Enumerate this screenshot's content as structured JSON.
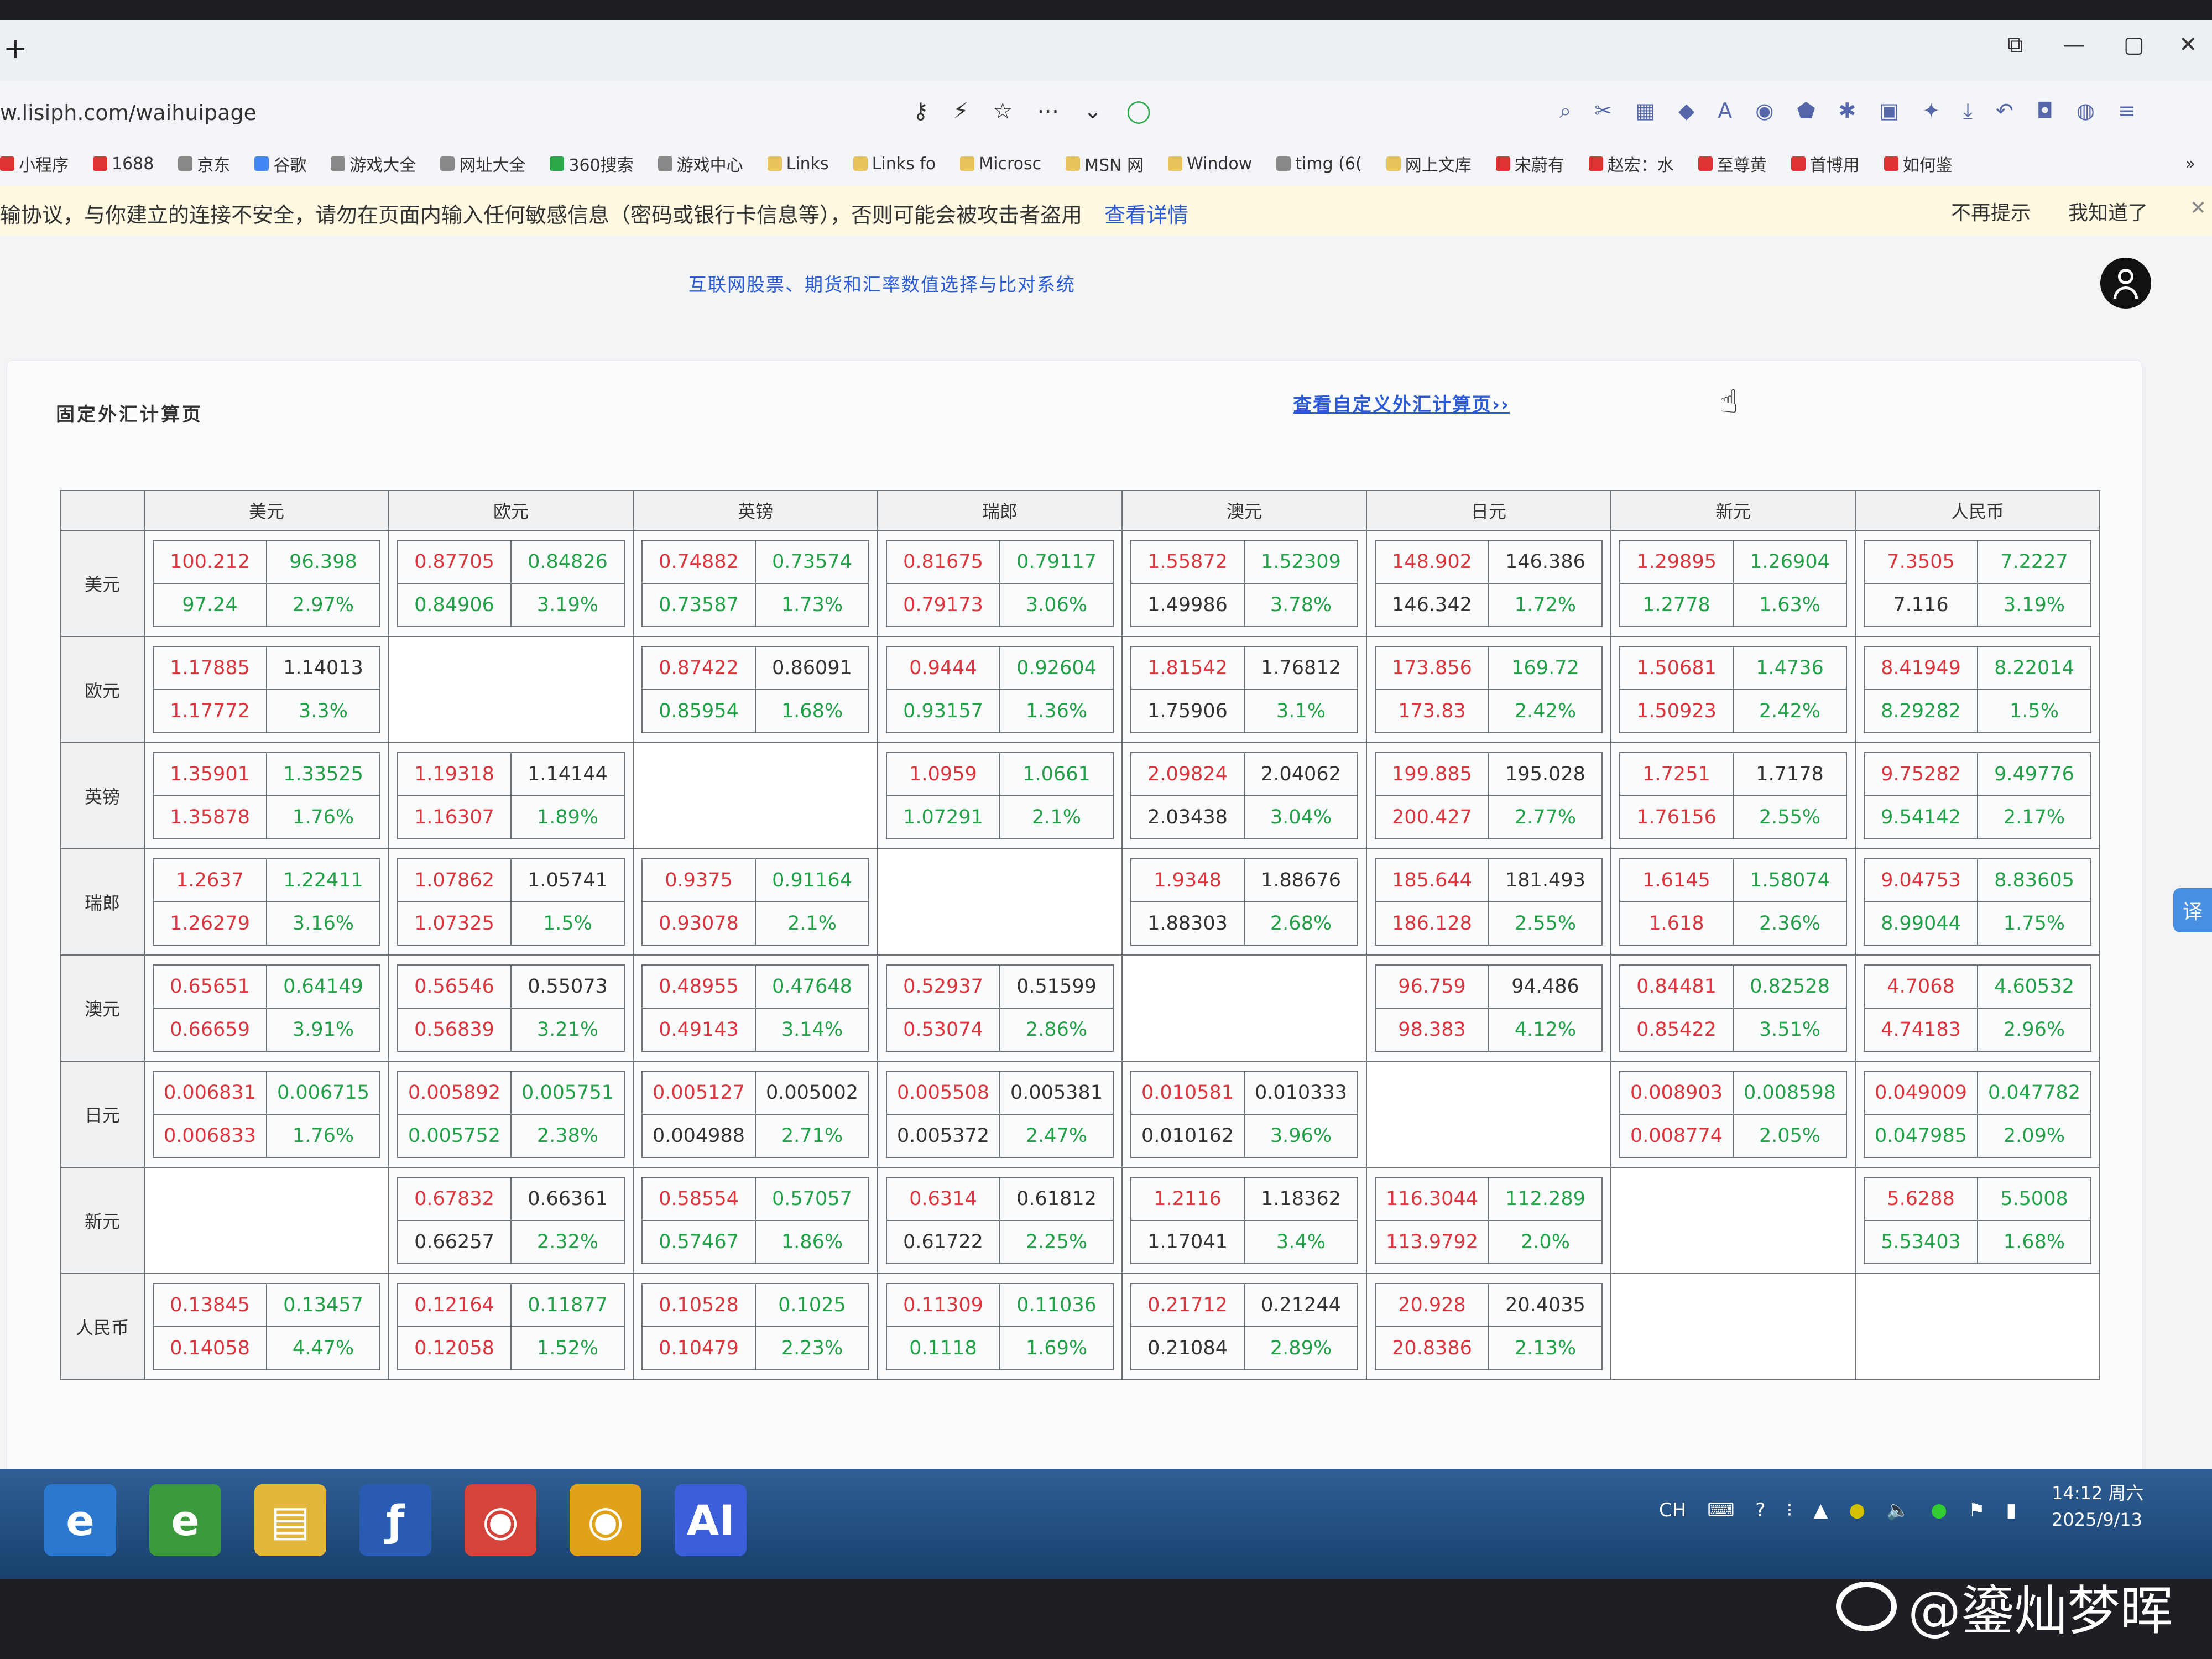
{
  "browser": {
    "new_tab_icon": "+",
    "url": "w.lisiph.com/waihuipage",
    "window_controls": [
      "⧉",
      "—",
      "▢",
      "✕"
    ],
    "bookmarks": [
      {
        "label": "小程序",
        "icon": "red"
      },
      {
        "label": "1688",
        "icon": "red"
      },
      {
        "label": "京东",
        "icon": "gear"
      },
      {
        "label": "谷歌",
        "icon": "g"
      },
      {
        "label": "游戏大全",
        "icon": "gear"
      },
      {
        "label": "网址大全",
        "icon": "gear"
      },
      {
        "label": "360搜索",
        "icon": "green"
      },
      {
        "label": "游戏中心",
        "icon": "gear"
      },
      {
        "label": "Links",
        "icon": "folder"
      },
      {
        "label": "Links fo",
        "icon": "folder"
      },
      {
        "label": "Microsc",
        "icon": "folder"
      },
      {
        "label": "MSN 网",
        "icon": "folder"
      },
      {
        "label": "Window",
        "icon": "folder"
      },
      {
        "label": "timg (6(",
        "icon": "gear"
      },
      {
        "label": "网上文库",
        "icon": "folder"
      },
      {
        "label": "宋蔚有",
        "icon": "red"
      },
      {
        "label": "赵宏：水",
        "icon": "red"
      },
      {
        "label": "至尊黄",
        "icon": "red"
      },
      {
        "label": "首博用",
        "icon": "red"
      },
      {
        "label": "如何鉴",
        "icon": "red"
      }
    ],
    "more_bookmarks": "»"
  },
  "warning": {
    "message": "输协议，与你建立的连接不安全，请勿在页面内输入任何敏感信息（密码或银行卡信息等），否则可能会被攻击者盗用",
    "details_link": "查看详情",
    "dont_remind": "不再提示",
    "got_it": "我知道了",
    "close": "✕"
  },
  "page": {
    "system_title": "互联网股票、期货和汇率数值选择与比对系统",
    "panel_title": "固定外汇计算页",
    "custom_link": "查看自定义外汇计算页››"
  },
  "table": {
    "columns": [
      "美元",
      "欧元",
      "英镑",
      "瑞郎",
      "澳元",
      "日元",
      "新元",
      "人民币"
    ],
    "rows": [
      {
        "label": "美元",
        "cells": [
          [
            [
              "100.212",
              "r"
            ],
            [
              "96.398",
              "g"
            ],
            [
              "97.24",
              "g"
            ],
            [
              "2.97%",
              "g"
            ]
          ],
          [
            [
              "0.87705",
              "r"
            ],
            [
              "0.84826",
              "g"
            ],
            [
              "0.84906",
              "g"
            ],
            [
              "3.19%",
              "g"
            ]
          ],
          [
            [
              "0.74882",
              "r"
            ],
            [
              "0.73574",
              "g"
            ],
            [
              "0.73587",
              "g"
            ],
            [
              "1.73%",
              "g"
            ]
          ],
          [
            [
              "0.81675",
              "r"
            ],
            [
              "0.79117",
              "g"
            ],
            [
              "0.79173",
              "r"
            ],
            [
              "3.06%",
              "g"
            ]
          ],
          [
            [
              "1.55872",
              "r"
            ],
            [
              "1.52309",
              "g"
            ],
            [
              "1.49986",
              "k"
            ],
            [
              "3.78%",
              "g"
            ]
          ],
          [
            [
              "148.902",
              "r"
            ],
            [
              "146.386",
              "k"
            ],
            [
              "146.342",
              "k"
            ],
            [
              "1.72%",
              "g"
            ]
          ],
          [
            [
              "1.29895",
              "r"
            ],
            [
              "1.26904",
              "g"
            ],
            [
              "1.2778",
              "g"
            ],
            [
              "1.63%",
              "g"
            ]
          ],
          [
            [
              "7.3505",
              "r"
            ],
            [
              "7.2227",
              "g"
            ],
            [
              "7.116",
              "k"
            ],
            [
              "3.19%",
              "g"
            ]
          ]
        ]
      },
      {
        "label": "欧元",
        "cells": [
          [
            [
              "1.17885",
              "r"
            ],
            [
              "1.14013",
              "k"
            ],
            [
              "1.17772",
              "r"
            ],
            [
              "3.3%",
              "g"
            ]
          ],
          null,
          [
            [
              "0.87422",
              "r"
            ],
            [
              "0.86091",
              "k"
            ],
            [
              "0.85954",
              "g"
            ],
            [
              "1.68%",
              "g"
            ]
          ],
          [
            [
              "0.9444",
              "r"
            ],
            [
              "0.92604",
              "g"
            ],
            [
              "0.93157",
              "g"
            ],
            [
              "1.36%",
              "g"
            ]
          ],
          [
            [
              "1.81542",
              "r"
            ],
            [
              "1.76812",
              "k"
            ],
            [
              "1.75906",
              "k"
            ],
            [
              "3.1%",
              "g"
            ]
          ],
          [
            [
              "173.856",
              "r"
            ],
            [
              "169.72",
              "g"
            ],
            [
              "173.83",
              "r"
            ],
            [
              "2.42%",
              "g"
            ]
          ],
          [
            [
              "1.50681",
              "r"
            ],
            [
              "1.4736",
              "g"
            ],
            [
              "1.50923",
              "r"
            ],
            [
              "2.42%",
              "g"
            ]
          ],
          [
            [
              "8.41949",
              "r"
            ],
            [
              "8.22014",
              "g"
            ],
            [
              "8.29282",
              "g"
            ],
            [
              "1.5%",
              "g"
            ]
          ]
        ]
      },
      {
        "label": "英镑",
        "cells": [
          [
            [
              "1.35901",
              "r"
            ],
            [
              "1.33525",
              "g"
            ],
            [
              "1.35878",
              "r"
            ],
            [
              "1.76%",
              "g"
            ]
          ],
          [
            [
              "1.19318",
              "r"
            ],
            [
              "1.14144",
              "k"
            ],
            [
              "1.16307",
              "r"
            ],
            [
              "1.89%",
              "g"
            ]
          ],
          null,
          [
            [
              "1.0959",
              "r"
            ],
            [
              "1.0661",
              "g"
            ],
            [
              "1.07291",
              "g"
            ],
            [
              "2.1%",
              "g"
            ]
          ],
          [
            [
              "2.09824",
              "r"
            ],
            [
              "2.04062",
              "k"
            ],
            [
              "2.03438",
              "k"
            ],
            [
              "3.04%",
              "g"
            ]
          ],
          [
            [
              "199.885",
              "r"
            ],
            [
              "195.028",
              "k"
            ],
            [
              "200.427",
              "r"
            ],
            [
              "2.77%",
              "g"
            ]
          ],
          [
            [
              "1.7251",
              "r"
            ],
            [
              "1.7178",
              "k"
            ],
            [
              "1.76156",
              "r"
            ],
            [
              "2.55%",
              "g"
            ]
          ],
          [
            [
              "9.75282",
              "r"
            ],
            [
              "9.49776",
              "g"
            ],
            [
              "9.54142",
              "g"
            ],
            [
              "2.17%",
              "g"
            ]
          ]
        ]
      },
      {
        "label": "瑞郎",
        "cells": [
          [
            [
              "1.2637",
              "r"
            ],
            [
              "1.22411",
              "g"
            ],
            [
              "1.26279",
              "r"
            ],
            [
              "3.16%",
              "g"
            ]
          ],
          [
            [
              "1.07862",
              "r"
            ],
            [
              "1.05741",
              "k"
            ],
            [
              "1.07325",
              "r"
            ],
            [
              "1.5%",
              "g"
            ]
          ],
          [
            [
              "0.9375",
              "r"
            ],
            [
              "0.91164",
              "g"
            ],
            [
              "0.93078",
              "r"
            ],
            [
              "2.1%",
              "g"
            ]
          ],
          null,
          [
            [
              "1.9348",
              "r"
            ],
            [
              "1.88676",
              "k"
            ],
            [
              "1.88303",
              "k"
            ],
            [
              "2.68%",
              "g"
            ]
          ],
          [
            [
              "185.644",
              "r"
            ],
            [
              "181.493",
              "k"
            ],
            [
              "186.128",
              "r"
            ],
            [
              "2.55%",
              "g"
            ]
          ],
          [
            [
              "1.6145",
              "r"
            ],
            [
              "1.58074",
              "g"
            ],
            [
              "1.618",
              "r"
            ],
            [
              "2.36%",
              "g"
            ]
          ],
          [
            [
              "9.04753",
              "r"
            ],
            [
              "8.83605",
              "g"
            ],
            [
              "8.99044",
              "g"
            ],
            [
              "1.75%",
              "g"
            ]
          ]
        ]
      },
      {
        "label": "澳元",
        "cells": [
          [
            [
              "0.65651",
              "r"
            ],
            [
              "0.64149",
              "g"
            ],
            [
              "0.66659",
              "r"
            ],
            [
              "3.91%",
              "g"
            ]
          ],
          [
            [
              "0.56546",
              "r"
            ],
            [
              "0.55073",
              "k"
            ],
            [
              "0.56839",
              "r"
            ],
            [
              "3.21%",
              "g"
            ]
          ],
          [
            [
              "0.48955",
              "r"
            ],
            [
              "0.47648",
              "g"
            ],
            [
              "0.49143",
              "r"
            ],
            [
              "3.14%",
              "g"
            ]
          ],
          [
            [
              "0.52937",
              "r"
            ],
            [
              "0.51599",
              "k"
            ],
            [
              "0.53074",
              "r"
            ],
            [
              "2.86%",
              "g"
            ]
          ],
          null,
          [
            [
              "96.759",
              "r"
            ],
            [
              "94.486",
              "k"
            ],
            [
              "98.383",
              "r"
            ],
            [
              "4.12%",
              "g"
            ]
          ],
          [
            [
              "0.84481",
              "r"
            ],
            [
              "0.82528",
              "g"
            ],
            [
              "0.85422",
              "r"
            ],
            [
              "3.51%",
              "g"
            ]
          ],
          [
            [
              "4.7068",
              "r"
            ],
            [
              "4.60532",
              "g"
            ],
            [
              "4.74183",
              "r"
            ],
            [
              "2.96%",
              "g"
            ]
          ]
        ]
      },
      {
        "label": "日元",
        "cells": [
          [
            [
              "0.006831",
              "r"
            ],
            [
              "0.006715",
              "g"
            ],
            [
              "0.006833",
              "r"
            ],
            [
              "1.76%",
              "g"
            ]
          ],
          [
            [
              "0.005892",
              "r"
            ],
            [
              "0.005751",
              "g"
            ],
            [
              "0.005752",
              "g"
            ],
            [
              "2.38%",
              "g"
            ]
          ],
          [
            [
              "0.005127",
              "r"
            ],
            [
              "0.005002",
              "k"
            ],
            [
              "0.004988",
              "k"
            ],
            [
              "2.71%",
              "g"
            ]
          ],
          [
            [
              "0.005508",
              "r"
            ],
            [
              "0.005381",
              "k"
            ],
            [
              "0.005372",
              "k"
            ],
            [
              "2.47%",
              "g"
            ]
          ],
          [
            [
              "0.010581",
              "r"
            ],
            [
              "0.010333",
              "k"
            ],
            [
              "0.010162",
              "k"
            ],
            [
              "3.96%",
              "g"
            ]
          ],
          null,
          [
            [
              "0.008903",
              "r"
            ],
            [
              "0.008598",
              "g"
            ],
            [
              "0.008774",
              "r"
            ],
            [
              "2.05%",
              "g"
            ]
          ],
          [
            [
              "0.049009",
              "r"
            ],
            [
              "0.047782",
              "g"
            ],
            [
              "0.047985",
              "g"
            ],
            [
              "2.09%",
              "g"
            ]
          ]
        ]
      },
      {
        "label": "新元",
        "cells": [
          null,
          [
            [
              "0.67832",
              "r"
            ],
            [
              "0.66361",
              "k"
            ],
            [
              "0.66257",
              "k"
            ],
            [
              "2.32%",
              "g"
            ]
          ],
          [
            [
              "0.58554",
              "r"
            ],
            [
              "0.57057",
              "g"
            ],
            [
              "0.57467",
              "g"
            ],
            [
              "1.86%",
              "g"
            ]
          ],
          [
            [
              "0.6314",
              "r"
            ],
            [
              "0.61812",
              "k"
            ],
            [
              "0.61722",
              "k"
            ],
            [
              "2.25%",
              "g"
            ]
          ],
          [
            [
              "1.2116",
              "r"
            ],
            [
              "1.18362",
              "k"
            ],
            [
              "1.17041",
              "k"
            ],
            [
              "3.4%",
              "g"
            ]
          ],
          [
            [
              "116.3044",
              "r"
            ],
            [
              "112.289",
              "g"
            ],
            [
              "113.9792",
              "r"
            ],
            [
              "2.0%",
              "g"
            ]
          ],
          null,
          [
            [
              "5.6288",
              "r"
            ],
            [
              "5.5008",
              "g"
            ],
            [
              "5.53403",
              "g"
            ],
            [
              "1.68%",
              "g"
            ]
          ]
        ]
      },
      {
        "label": "人民币",
        "cells": [
          [
            [
              "0.13845",
              "r"
            ],
            [
              "0.13457",
              "g"
            ],
            [
              "0.14058",
              "r"
            ],
            [
              "4.47%",
              "g"
            ]
          ],
          [
            [
              "0.12164",
              "r"
            ],
            [
              "0.11877",
              "g"
            ],
            [
              "0.12058",
              "r"
            ],
            [
              "1.52%",
              "g"
            ]
          ],
          [
            [
              "0.10528",
              "r"
            ],
            [
              "0.1025",
              "g"
            ],
            [
              "0.10479",
              "r"
            ],
            [
              "2.23%",
              "g"
            ]
          ],
          [
            [
              "0.11309",
              "r"
            ],
            [
              "0.11036",
              "g"
            ],
            [
              "0.1118",
              "g"
            ],
            [
              "1.69%",
              "g"
            ]
          ],
          [
            [
              "0.21712",
              "r"
            ],
            [
              "0.21244",
              "k"
            ],
            [
              "0.21084",
              "k"
            ],
            [
              "2.89%",
              "g"
            ]
          ],
          [
            [
              "20.928",
              "r"
            ],
            [
              "20.4035",
              "k"
            ],
            [
              "20.8386",
              "r"
            ],
            [
              "2.13%",
              "g"
            ]
          ],
          null,
          null
        ]
      }
    ]
  },
  "taskbar": {
    "tray_lang": "CH",
    "time": "14:12 周六",
    "date": "2025/9/13"
  },
  "watermark": "@鎏灿梦晖",
  "colors": {
    "red": "#d9363e",
    "green": "#24a148",
    "link": "#2a5ad6"
  }
}
